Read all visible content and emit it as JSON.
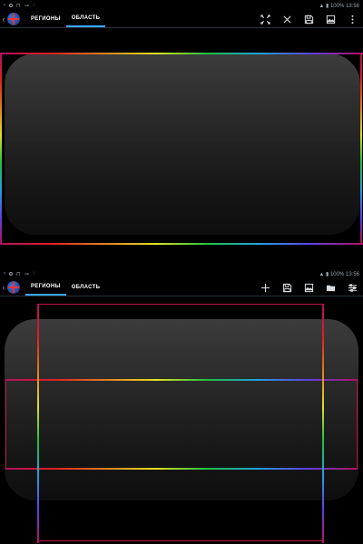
{
  "status_bar": {
    "left_icons": [
      "chevron-left-icon",
      "settings-icon",
      "copy-icon",
      "link-icon",
      "shield-icon"
    ],
    "right_text": "▲ ▮ 100% 13:56"
  },
  "top_pane": {
    "tabs": [
      {
        "label": "РЕГИОНЫ",
        "active": false
      },
      {
        "label": "ОБЛАСТЬ",
        "active": true
      }
    ],
    "toolbar_icons": [
      "fit-icon",
      "close-icon",
      "save-icon",
      "image-icon",
      "more-icon"
    ]
  },
  "bottom_pane": {
    "tabs": [
      {
        "label": "РЕГИОНЫ",
        "active": true
      },
      {
        "label": "ОБЛАСТЬ",
        "active": false
      }
    ],
    "toolbar_icons": [
      "add-icon",
      "save-icon",
      "image-icon",
      "folder-icon",
      "settings-icon"
    ]
  },
  "colors": {
    "accent": "#39a7ff",
    "frame_red": "#c0103a",
    "background": "#000000"
  }
}
